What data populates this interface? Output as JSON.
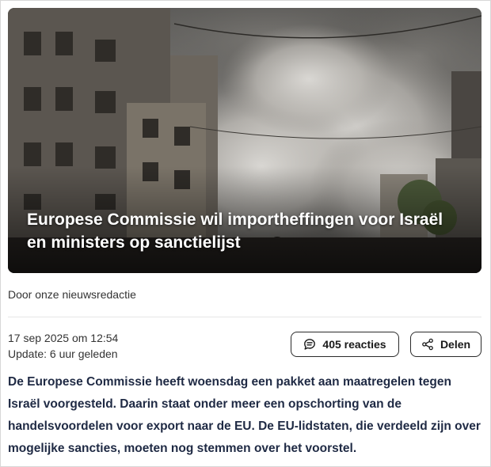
{
  "article": {
    "title": "Europese Commissie wil importheffingen voor Israël en ministers op sanctielijst",
    "byline": "Door onze nieuwsredactie",
    "published": "17 sep 2025 om 12:54",
    "updated": "Update: 6 uur geleden",
    "lead": "De Europese Commissie heeft woensdag een pakket aan maatregelen tegen Israël voorgesteld. Daarin staat onder meer een opschorting van de handelsvoordelen voor export naar de EU. De EU-lidstaten, die verdeeld zijn over mogelijke sancties, moeten nog stemmen over het voorstel."
  },
  "actions": {
    "comments_label": "405 reacties",
    "comments_icon": "speech-bubble-icon",
    "share_label": "Delen",
    "share_icon": "share-icon"
  },
  "colors": {
    "lead_text": "#1f2a44",
    "button_border": "#2a2a2a",
    "divider": "#e6e6e6"
  }
}
